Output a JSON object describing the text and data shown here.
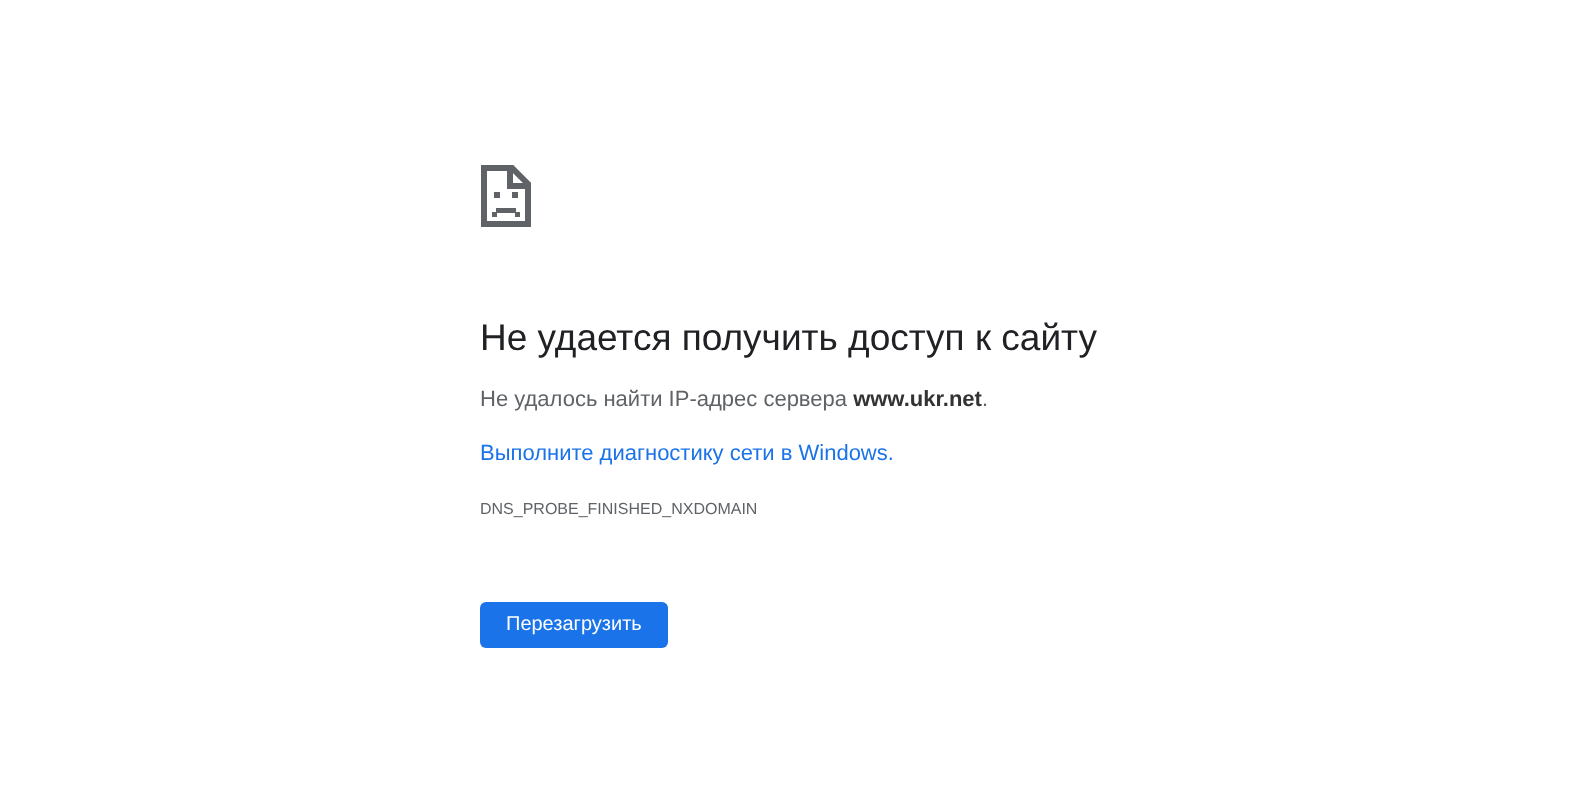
{
  "heading": "Не удается получить доступ к сайту",
  "description": "Не удалось найти IP-адрес сервера **www.ukr.net**.",
  "diagnostics_link": "Выполните диагностику сети в Windows.",
  "error_code": "DNS_PROBE_FINISHED_NXDOMAIN",
  "reload_button": "Перезагрузить"
}
